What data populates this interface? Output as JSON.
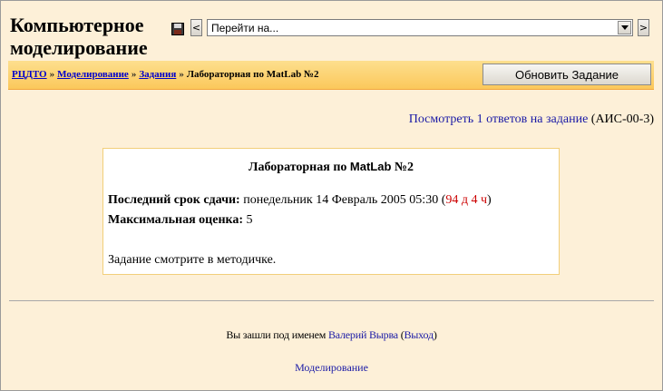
{
  "header": {
    "site_title": "Компьютерное моделирование",
    "jump_to": {
      "placeholder": "Перейти на..."
    },
    "icons": {
      "save": "save-icon",
      "prev": "arrow-left-icon",
      "next": "arrow-right-icon",
      "dropdown": "chevron-down-icon"
    },
    "prev_glyph": "<",
    "next_glyph": ">",
    "dropdown_glyph": "▼"
  },
  "navbar": {
    "breadcrumbs": [
      {
        "label": "РЦДТО",
        "link": true
      },
      {
        "label": "Моделирование",
        "link": true
      },
      {
        "label": "Задания",
        "link": true
      },
      {
        "label": "Лабораторная по MatLab №2",
        "link": false
      }
    ],
    "separator": "»",
    "update_button": "Обновить Задание"
  },
  "submissions": {
    "link_text": "Посмотреть 1 ответов на задание",
    "group": "(АИС-00-3)"
  },
  "assignment": {
    "title_prefix": "Лабораторная по ",
    "title_mono": "MatLab",
    "title_suffix": " №2",
    "deadline_label": "Последний срок сдачи:",
    "deadline_value": "понедельник 14 Февраль 2005 05:30",
    "time_left": "94 д 4 ч",
    "grade_label": "Максимальная оценка:",
    "grade_value": "5",
    "description": "Задание смотрите в методичке."
  },
  "footer": {
    "logged_in_prefix": "Вы зашли под именем ",
    "user_name": "Валерий Вырва",
    "logout_label": "Выход",
    "course_link": "Моделирование"
  },
  "colors": {
    "background": "#fdf0d8",
    "navbar": "#fbc85b",
    "link": "#0000cc",
    "time_left": "#cc0000"
  }
}
